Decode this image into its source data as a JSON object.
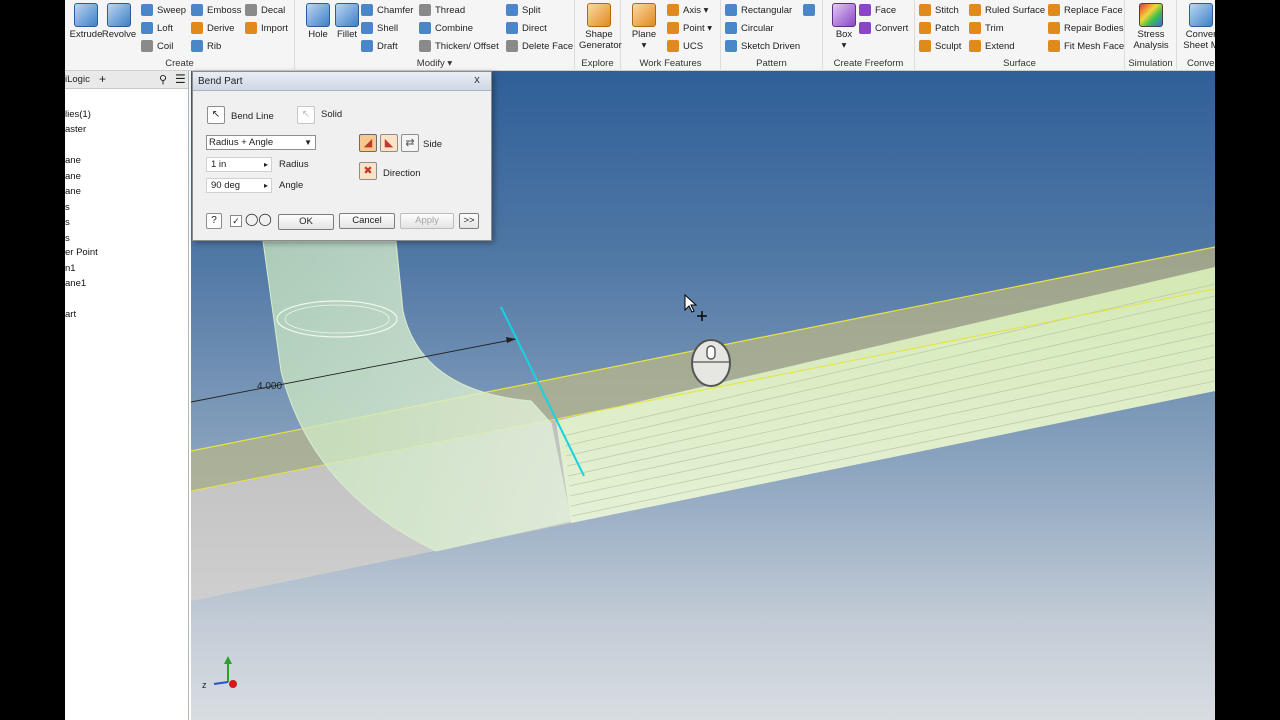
{
  "ribbon": {
    "create": {
      "label": "Create",
      "extrude": "Extrude",
      "revolve": "Revolve",
      "sweep": "Sweep",
      "loft": "Loft",
      "coil": "Coil",
      "emboss": "Emboss",
      "derive": "Derive",
      "rib": "Rib",
      "decal": "Decal",
      "import": "Import"
    },
    "modify": {
      "label": "Modify",
      "hole": "Hole",
      "fillet": "Fillet",
      "chamfer": "Chamfer",
      "shell": "Shell",
      "draft": "Draft",
      "thread": "Thread",
      "combine": "Combine",
      "thicken_offset": "Thicken/ Offset",
      "split": "Split",
      "direct": "Direct",
      "delete_face": "Delete Face"
    },
    "explore": {
      "label": "Explore",
      "shape_generator_1": "Shape",
      "shape_generator_2": "Generator"
    },
    "work_features": {
      "label": "Work Features",
      "plane": "Plane",
      "axis": "Axis",
      "point": "Point",
      "ucs": "UCS"
    },
    "pattern": {
      "label": "Pattern",
      "rectangular": "Rectangular",
      "circular": "Circular",
      "sketch_driven": "Sketch Driven"
    },
    "freeform": {
      "label": "Create Freeform",
      "box": "Box",
      "face": "Face",
      "convert": "Convert"
    },
    "surface": {
      "label": "Surface",
      "stitch": "Stitch",
      "patch": "Patch",
      "sculpt": "Sculpt",
      "ruled_surface": "Ruled Surface",
      "trim": "Trim",
      "extend": "Extend",
      "replace_face": "Replace Face",
      "repair_bodies": "Repair Bodies",
      "fit_mesh_face": "Fit Mesh Face"
    },
    "simulation": {
      "label": "Simulation",
      "stress_1": "Stress",
      "stress_2": "Analysis"
    },
    "convert": {
      "label": "Conve",
      "convert_1": "Conver",
      "convert_2": "Sheet M"
    }
  },
  "browser": {
    "title": "iLogic",
    "add": "+",
    "items": [
      "lies(1)",
      "aster",
      "ane",
      "ane",
      "ane",
      "s",
      "s",
      "s",
      "er Point",
      "n1",
      "ane1",
      "art"
    ]
  },
  "dialog": {
    "title": "Bend Part",
    "close": "x",
    "bend_line": "Bend Line",
    "solid": "Solid",
    "method": "Radius + Angle",
    "radius_value": "1 in",
    "radius_label": "Radius",
    "angle_value": "90 deg",
    "angle_label": "Angle",
    "side_label": "Side",
    "direction_label": "Direction",
    "ok": "OK",
    "cancel": "Cancel",
    "apply": "Apply",
    "more": ">>"
  },
  "viewport": {
    "dimension": "4.000",
    "triad_z": "z"
  },
  "colors": {
    "accent": "#3f7fc5",
    "tube_highlight": "#cfe8b0",
    "bend_line": "#16d3e0"
  }
}
